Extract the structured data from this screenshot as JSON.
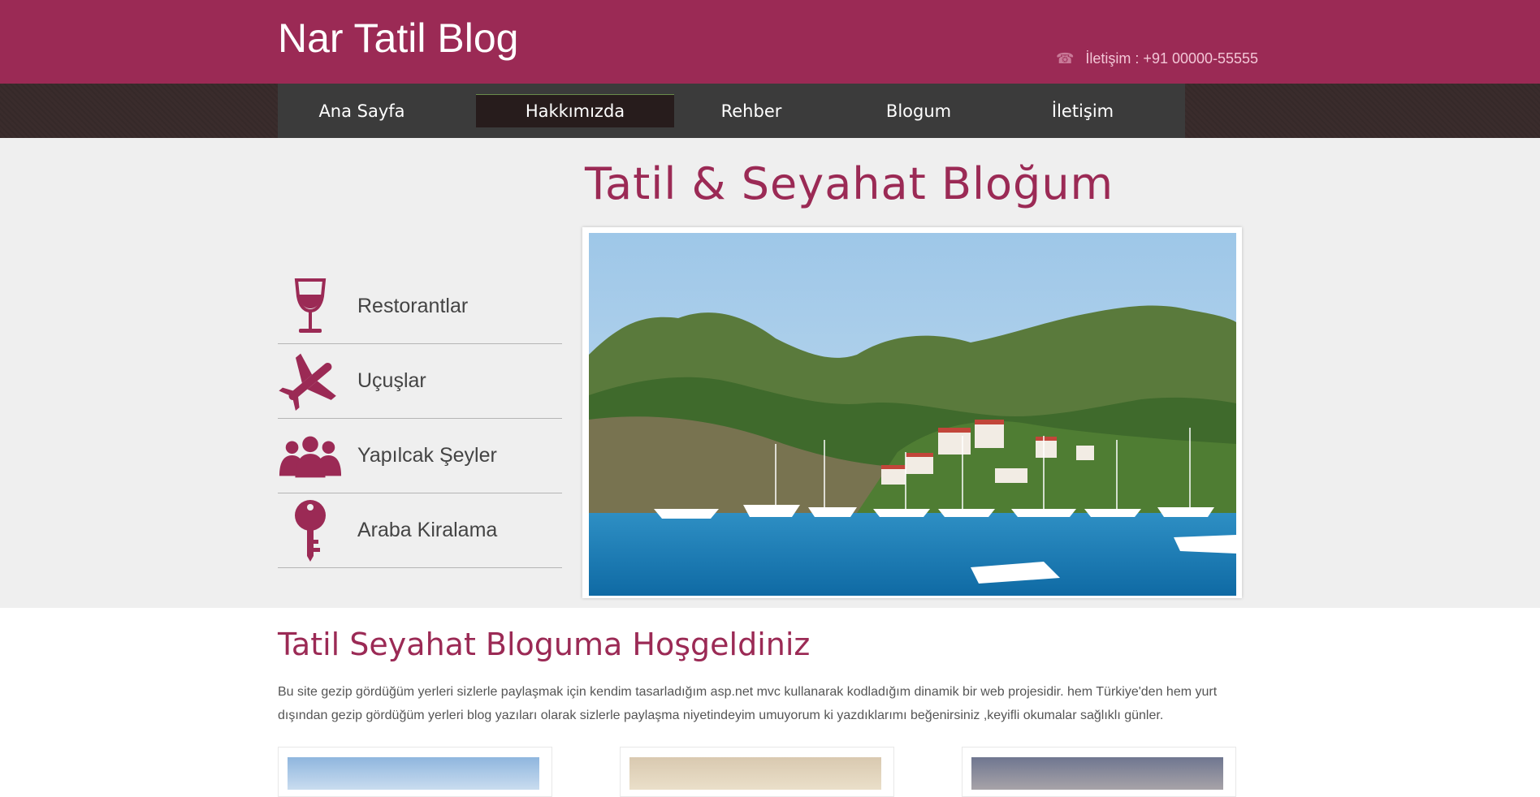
{
  "header": {
    "site_title": "Nar Tatil Blog",
    "contact_text": "İletişim : +91 00000-55555",
    "contact_icon": "phone-icon"
  },
  "nav": {
    "items": [
      {
        "label": "Ana Sayfa"
      },
      {
        "label": "Hakkımızda",
        "active": true
      },
      {
        "label": "Rehber"
      },
      {
        "label": "Blogum"
      },
      {
        "label": "İletişim"
      }
    ]
  },
  "banner": {
    "title": "Tatil & Seyahat Bloğum",
    "side_items": [
      {
        "label": "Restorantlar",
        "icon": "wine-glass-icon"
      },
      {
        "label": "Uçuşlar",
        "icon": "airplane-icon"
      },
      {
        "label": "Yapılcak Şeyler",
        "icon": "people-icon"
      },
      {
        "label": "Araba Kiralama",
        "icon": "key-icon"
      }
    ]
  },
  "content": {
    "welcome_title": "Tatil Seyahat Bloguma Hoşgeldiniz",
    "description": "Bu site gezip gördüğüm yerleri sizlerle paylaşmak için kendim tasarladığım asp.net mvc kullanarak kodladığım dinamik bir web projesidir. hem Türkiye'den hem yurt dışından gezip gördüğüm yerleri blog yazıları olarak sizlerle paylaşma niyetindeyim umuyorum ki yazdıklarımı beğenirsiniz ,keyifli okumalar sağlıklı günler."
  },
  "colors": {
    "brand": "#9b2a55",
    "nav_bg": "#3b3b3b",
    "banner_bg": "#efefef"
  }
}
